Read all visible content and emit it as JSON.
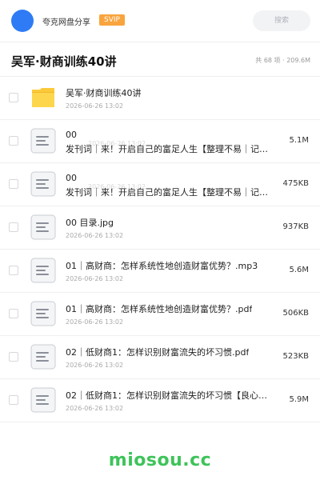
{
  "header": {
    "brand": "夸克网盘分享",
    "badge": "SVIP",
    "search_placeholder": "搜索"
  },
  "folder": {
    "title": "吴军·财商训练40讲",
    "meta": "共 68 项 · 209.6M"
  },
  "items": [
    {
      "type": "folder",
      "name": "吴军·财商训练40讲",
      "subline": "",
      "watermark": "",
      "date": "2026-06-26 13:02",
      "size": ""
    },
    {
      "type": "file",
      "name": "00",
      "subline": "发刊词｜来！开启自己的富足人生【整理不易｜记…",
      "watermark": "2026-06-26 13:02",
      "date": "",
      "size": "5.1M"
    },
    {
      "type": "file",
      "name": "00",
      "subline": "发刊词｜来！开启自己的富足人生【整理不易｜记…",
      "watermark": "2026-06-26 13:02",
      "date": "",
      "size": "475KB"
    },
    {
      "type": "file",
      "name": "00 目录.jpg",
      "subline": "",
      "watermark": "",
      "date": "2026-06-26 13:02",
      "size": "937KB"
    },
    {
      "type": "file",
      "name": "01｜高财商：怎样系统性地创造财富优势？.mp3",
      "subline": "",
      "watermark": "",
      "date": "2026-06-26 13:02",
      "size": "5.6M"
    },
    {
      "type": "file",
      "name": "01｜高财商：怎样系统性地创造财富优势？.pdf",
      "subline": "",
      "watermark": "",
      "date": "2026-06-26 13:02",
      "size": "506KB"
    },
    {
      "type": "file",
      "name": "02｜低财商1：怎样识别财富流失的坏习惯.pdf",
      "subline": "",
      "watermark": "",
      "date": "2026-06-26 13:02",
      "size": "523KB"
    },
    {
      "type": "file",
      "name": "02｜低财商1：怎样识别财富流失的坏习惯【良心整理…",
      "subline": "",
      "watermark": "",
      "date": "2026-06-26 13:02",
      "size": "5.9M"
    }
  ],
  "footer": {
    "watermark": "miosou.cc"
  },
  "colors": {
    "accent": "#2f7bf5",
    "badge": "#f9a43d",
    "folder": "#fcc93a",
    "footer": "#3ec35a"
  }
}
